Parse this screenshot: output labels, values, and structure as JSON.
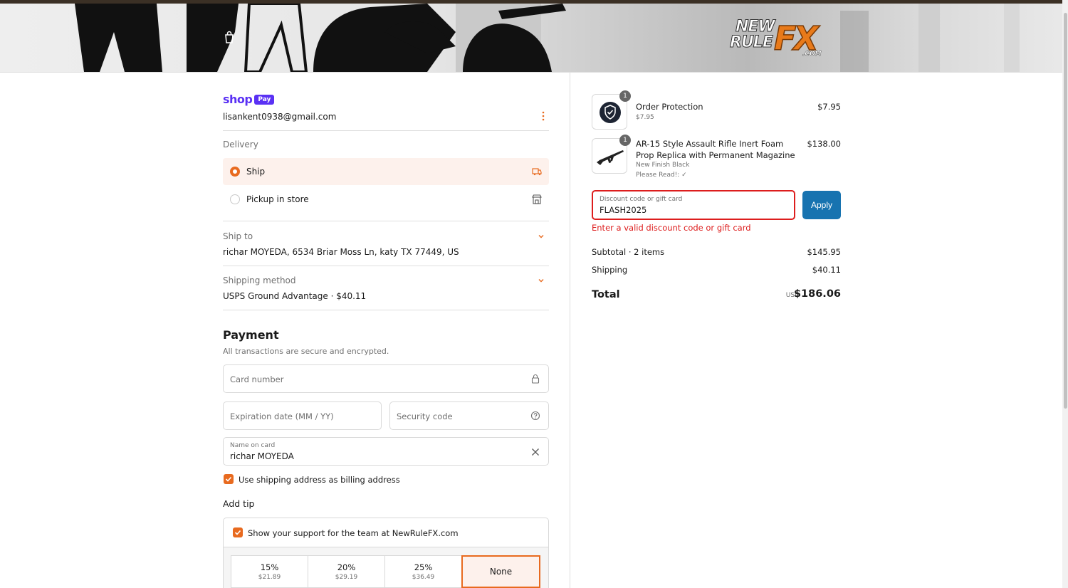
{
  "header": {
    "logo_line1": "NEW",
    "logo_line2": "RULE",
    "logo_fx": "FX",
    "logo_com": ".COM"
  },
  "account": {
    "shop_text": "shop",
    "pay_text": "Pay",
    "email": "lisankent0938@gmail.com"
  },
  "delivery": {
    "label": "Delivery",
    "options": [
      {
        "label": "Ship",
        "selected": true
      },
      {
        "label": "Pickup in store",
        "selected": false
      }
    ]
  },
  "ship_to": {
    "label": "Ship to",
    "value": "richar MOYEDA, 6534 Briar Moss Ln, katy TX 77449, US"
  },
  "shipping_method": {
    "label": "Shipping method",
    "value": "USPS Ground Advantage · $40.11"
  },
  "payment": {
    "title": "Payment",
    "subtitle": "All transactions are secure and encrypted.",
    "card_number_placeholder": "Card number",
    "expiration_placeholder": "Expiration date (MM / YY)",
    "security_placeholder": "Security code",
    "name_label": "Name on card",
    "name_value": "richar MOYEDA",
    "billing_checkbox_label": "Use shipping address as billing address"
  },
  "tip": {
    "title": "Add tip",
    "support_label": "Show your support for the team at NewRuleFX.com",
    "options": [
      {
        "pct": "15%",
        "amt": "$21.89"
      },
      {
        "pct": "20%",
        "amt": "$29.19"
      },
      {
        "pct": "25%",
        "amt": "$36.49"
      },
      {
        "pct": "None",
        "amt": ""
      }
    ],
    "selected": "None"
  },
  "order": {
    "items": [
      {
        "qty": "1",
        "name": "Order Protection",
        "sub1": "$7.95",
        "sub2": "",
        "price": "$7.95"
      },
      {
        "qty": "1",
        "name": "AR-15 Style Assault Rifle Inert Foam Prop Replica with Permanent Magazine",
        "sub1": "New Finish Black",
        "sub2": "Please Read!: ✓",
        "price": "$138.00"
      }
    ],
    "discount_label": "Discount code or gift card",
    "discount_value": "FLASH2025",
    "apply_label": "Apply",
    "error": "Enter a valid discount code or gift card",
    "subtotal_label": "Subtotal · 2 items",
    "subtotal_value": "$145.95",
    "shipping_label": "Shipping",
    "shipping_value": "$40.11",
    "total_label": "Total",
    "total_currency": "USD",
    "total_value": "$186.06"
  },
  "colors": {
    "accent": "#e86a1f",
    "apply_button": "#1773b0",
    "error": "#dd1d1d",
    "shop_pay": "#5a31f4"
  },
  "icons": [
    "bag-icon",
    "kebab-icon",
    "truck-icon",
    "store-icon",
    "chevron-down-icon",
    "lock-icon",
    "help-circle-icon",
    "clear-icon",
    "shield-check-icon",
    "rifle-icon"
  ]
}
